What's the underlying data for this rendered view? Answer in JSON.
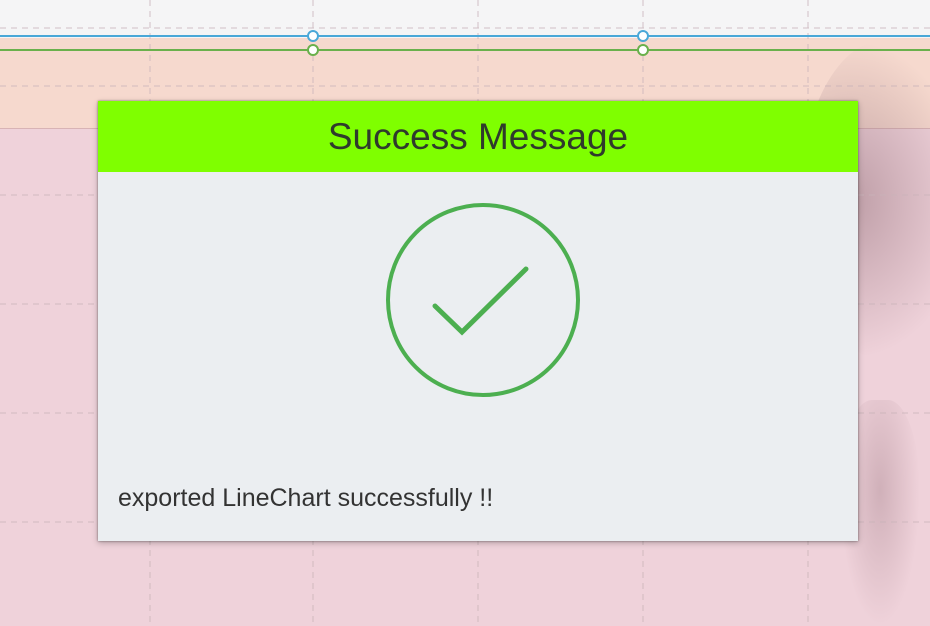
{
  "dialog": {
    "title": "Success Message",
    "message": "exported LineChart successfully !!",
    "icon": "checkmark-circle-icon",
    "header_color": "#7fff00",
    "icon_color": "#4caf50"
  },
  "background": {
    "chart_series_colors": [
      "#4aa8d8",
      "#6ab04c"
    ]
  }
}
